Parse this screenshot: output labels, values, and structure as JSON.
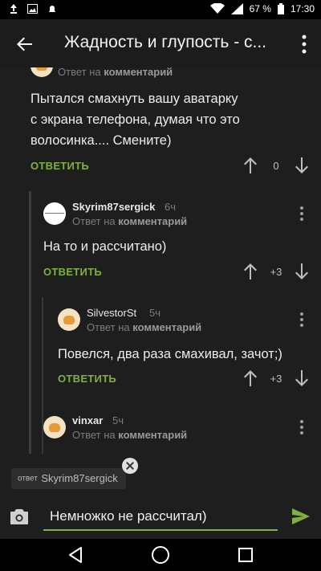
{
  "status_bar": {
    "battery": "67 %",
    "time": "17:30"
  },
  "app_bar": {
    "title": "Жадность и глупость - с..."
  },
  "comments": [
    {
      "reply_prefix": "Ответ на",
      "reply_target": "комментарий",
      "text_lines": [
        "Пытался смахнуть вашу аватарку",
        "с экрана телефона, думая что это",
        "волосинка.... Смените)"
      ],
      "reply_label": "ОТВЕТИТЬ",
      "score": "0"
    },
    {
      "username": "Skyrim87sergick",
      "time": "6ч",
      "reply_prefix": "Ответ на",
      "reply_target": "комментарий",
      "text": "На то и рассчитано)",
      "reply_label": "ОТВЕТИТЬ",
      "score": "+3"
    },
    {
      "username": "SilvestorSt",
      "time": "5ч",
      "reply_prefix": "Ответ на",
      "reply_target": "комментарий",
      "text": "Повелся, два раза смахивал, зачот;)",
      "reply_label": "ОТВЕТИТЬ",
      "score": "+3"
    },
    {
      "username": "vinxar",
      "time": "5ч",
      "reply_prefix": "Ответ на",
      "reply_target": "комментарий"
    }
  ],
  "reply_chip": {
    "label": "ответ",
    "username": "Skyrim87sergick"
  },
  "input": {
    "value": "Немножко не рассчитал)"
  },
  "colors": {
    "accent": "#7fb13f",
    "background": "#1e1e1e",
    "app_bar": "#1c1c1c"
  }
}
